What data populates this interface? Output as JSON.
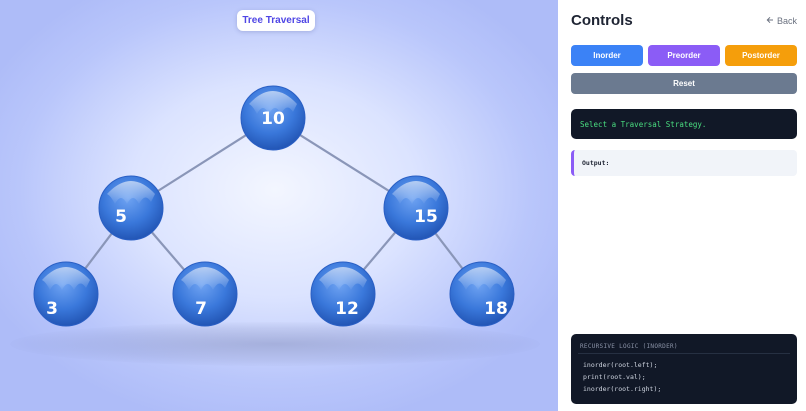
{
  "stage": {
    "title": "Tree Traversal"
  },
  "tree": {
    "nodes": [
      {
        "id": "n10",
        "value": "10"
      },
      {
        "id": "n5",
        "value": "5"
      },
      {
        "id": "n15",
        "value": "15"
      },
      {
        "id": "n3",
        "value": "3"
      },
      {
        "id": "n7",
        "value": "7"
      },
      {
        "id": "n12",
        "value": "12"
      },
      {
        "id": "n18",
        "value": "18"
      }
    ],
    "edges": [
      [
        "n10",
        "n5"
      ],
      [
        "n10",
        "n15"
      ],
      [
        "n5",
        "n3"
      ],
      [
        "n5",
        "n7"
      ],
      [
        "n15",
        "n12"
      ],
      [
        "n15",
        "n18"
      ]
    ],
    "node_color": "#3b7be0"
  },
  "panel": {
    "title": "Controls",
    "back_label": "Back",
    "back_icon": "arrow-left-icon",
    "buttons": {
      "inorder": "Inorder",
      "preorder": "Preorder",
      "postorder": "Postorder",
      "reset": "Reset"
    },
    "status_text": "Select a Traversal Strategy.",
    "output_label": "Output:",
    "output_value": "",
    "code": {
      "header": "RECURSIVE LOGIC (INORDER)",
      "lines": [
        "inorder(root.left);",
        "print(root.val);",
        "inorder(root.right);"
      ]
    }
  },
  "colors": {
    "inorder": "#3b82f6",
    "preorder": "#8b5cf6",
    "postorder": "#f59e0b",
    "reset": "#6b7a90",
    "status_text": "#4ade80"
  }
}
